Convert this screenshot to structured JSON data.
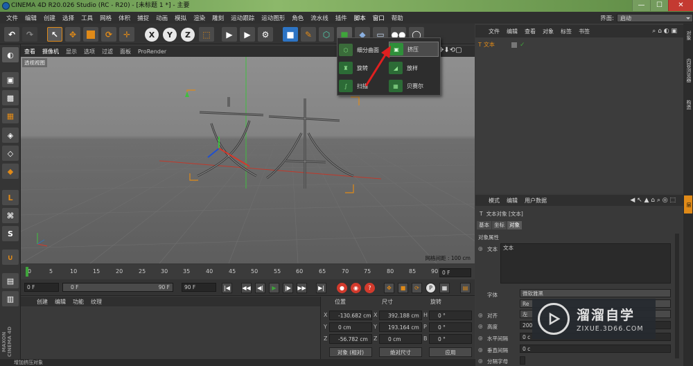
{
  "window": {
    "title": "CINEMA 4D R20.026 Studio (RC - R20) - [未标题 1 *] - 主要",
    "min": "—",
    "max": "☐",
    "close": "✕"
  },
  "menu": {
    "items": [
      "文件",
      "编辑",
      "创建",
      "选择",
      "工具",
      "网格",
      "体积",
      "捕捉",
      "动画",
      "模拟",
      "渲染",
      "雕刻",
      "运动跟踪",
      "运动图形",
      "角色",
      "流水线",
      "插件",
      "脚本",
      "窗口",
      "帮助"
    ],
    "layout_label": "界面:",
    "layout_value": "启动"
  },
  "toolbar": {
    "x": "X",
    "y": "Y",
    "z": "Z"
  },
  "viewport": {
    "menu": [
      "查看",
      "摄像机",
      "显示",
      "选项",
      "过滤",
      "面板",
      "ProRender"
    ],
    "label": "透视视图",
    "grid_note": "网格间距 : 100 cm",
    "object_text": "文本"
  },
  "popup": {
    "items": [
      {
        "label": "细分曲面",
        "icon": "subdivision-icon"
      },
      {
        "label": "挤压",
        "icon": "extrude-icon"
      },
      {
        "label": "旋转",
        "icon": "lathe-icon"
      },
      {
        "label": "放样",
        "icon": "loft-icon"
      },
      {
        "label": "扫描",
        "icon": "sweep-icon"
      },
      {
        "label": "贝赛尔",
        "icon": "bezier-icon"
      }
    ]
  },
  "timeline": {
    "ticks": [
      "0",
      "5",
      "10",
      "15",
      "20",
      "25",
      "30",
      "35",
      "40",
      "45",
      "50",
      "55",
      "60",
      "65",
      "70",
      "75",
      "80",
      "85",
      "90"
    ],
    "end_field": "0 F"
  },
  "playback": {
    "start": "0 F",
    "current": "0 F",
    "end_range": "90 F",
    "end": "90 F"
  },
  "materials": {
    "menu": [
      "创建",
      "编辑",
      "功能",
      "纹理"
    ]
  },
  "coords": {
    "headers": [
      "位置",
      "尺寸",
      "旋转"
    ],
    "pos": {
      "x": "-130.682 cm",
      "y": "0 cm",
      "z": "-56.782 cm"
    },
    "size": {
      "x": "392.188 cm",
      "y": "193.164 cm",
      "z": "0 cm"
    },
    "rot": {
      "h": "0 °",
      "p": "0 °",
      "b": "0 °"
    },
    "labels": {
      "x": "X",
      "y": "Y",
      "z": "Z",
      "h": "H",
      "p": "P",
      "b": "B"
    },
    "mode_object": "对象 (相对)",
    "mode_size": "绝对尺寸",
    "apply": "应用"
  },
  "objects": {
    "menu": [
      "文件",
      "编辑",
      "查看",
      "对象",
      "标签",
      "书签"
    ],
    "rows": [
      {
        "name": "文本"
      }
    ]
  },
  "right_tabs": [
    "对象",
    "内容浏览器",
    "构造",
    "层"
  ],
  "attributes": {
    "menu": [
      "模式",
      "编辑",
      "用户数据"
    ],
    "object_title": "文本对象 [文本]",
    "tabs": [
      "基本",
      "坐标",
      "对象"
    ],
    "section": "对象属性",
    "text_label": "文本",
    "text_value": "文本",
    "font_label": "字体",
    "font_value": "微软雅黑",
    "style_value": "Re",
    "align_label": "对齐",
    "align_value": "左",
    "height_label": "高度",
    "height_value": "200",
    "hspace_label": "水平间隔",
    "hspace_value": "0 c",
    "vspace_label": "垂直间隔",
    "vspace_value": "0 c",
    "sep_label": "分隔字母"
  },
  "watermark": {
    "title": "溜溜自学",
    "url": "ZIXUE.3D66.COM"
  },
  "status": "增加挤压对象",
  "brand": "MAXON CINEMA 4D",
  "colors": {
    "accent_orange": "#e08a18",
    "accent_blue": "#2d74c4",
    "green": "#3fa53b",
    "red": "#d23a2c"
  }
}
